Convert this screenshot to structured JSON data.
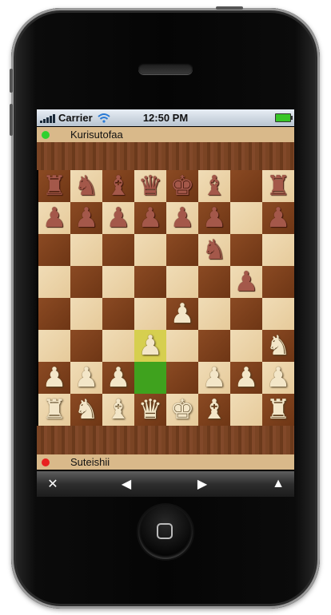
{
  "status_bar": {
    "carrier": "Carrier",
    "time": "12:50 PM"
  },
  "players": {
    "top": {
      "name": "Kurisutofaa",
      "status_color": "#2fd12f"
    },
    "bottom": {
      "name": "Suteishii",
      "status_color": "#e82020"
    }
  },
  "board": {
    "rows": [
      [
        "br",
        "bn",
        "bb",
        "bq",
        "bk",
        "bb",
        "",
        "br"
      ],
      [
        "bp",
        "bp",
        "bp",
        "bp",
        "bp",
        "bp",
        "",
        "bp"
      ],
      [
        "",
        "",
        "",
        "",
        "",
        "bn",
        "",
        ""
      ],
      [
        "",
        "",
        "",
        "",
        "",
        "",
        "bp",
        ""
      ],
      [
        "",
        "",
        "",
        "",
        "wp",
        "",
        "",
        ""
      ],
      [
        "",
        "",
        "",
        "wp",
        "",
        "",
        "",
        "wn"
      ],
      [
        "wp",
        "wp",
        "wp",
        "",
        "",
        "wp",
        "wp",
        "wp"
      ],
      [
        "wr",
        "wn",
        "wb",
        "wq",
        "wk",
        "wb",
        "",
        "wr"
      ]
    ],
    "highlight_from": {
      "row": 6,
      "col": 3
    },
    "highlight_to": {
      "row": 5,
      "col": 3
    }
  },
  "toolbar": {
    "close_icon": "✕",
    "back_icon": "◀",
    "forward_icon": "▶",
    "up_icon": "▲"
  }
}
